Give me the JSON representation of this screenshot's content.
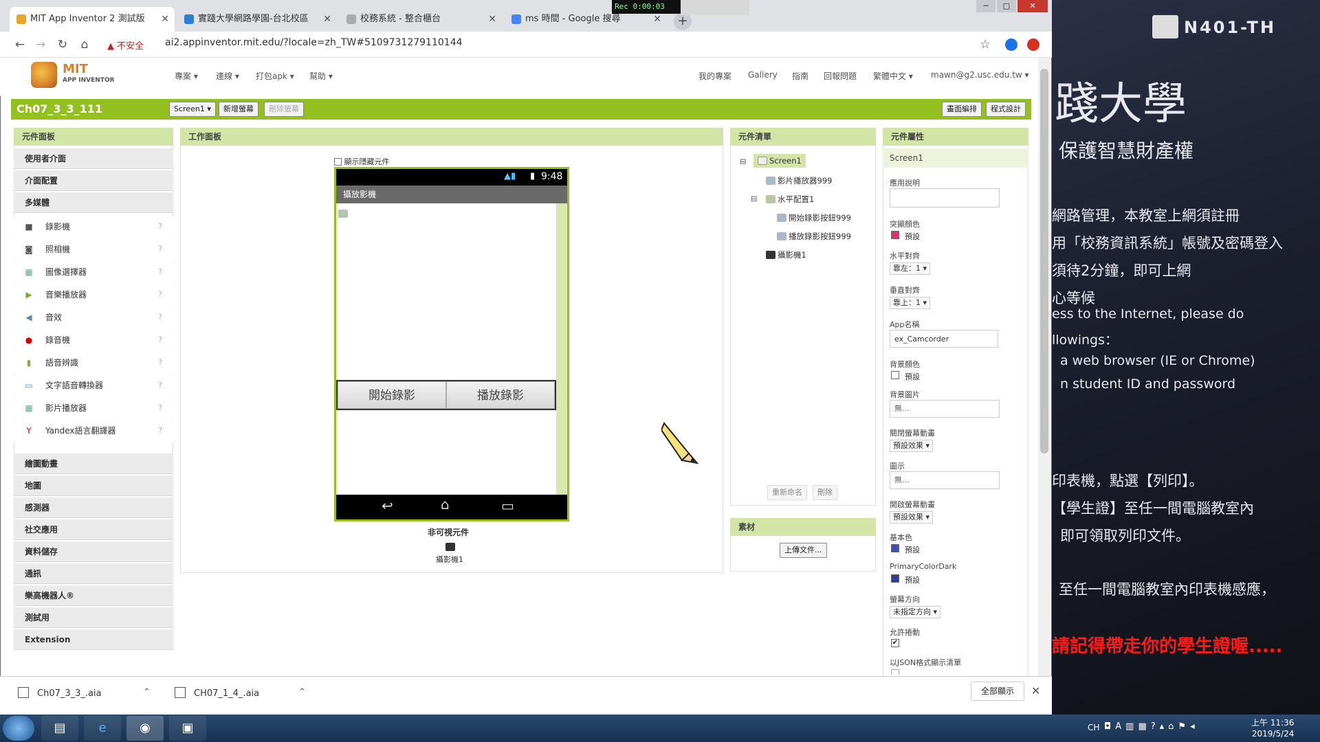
{
  "recorder": {
    "time": "Rec 0:00:03"
  },
  "tabs": [
    {
      "label": "MIT App Inventor 2 測試版",
      "color": "#e3a72f"
    },
    {
      "label": "實踐大學網路學園-台北校區",
      "color": "#2c7dd3"
    },
    {
      "label": "校務系統 - 整合櫃台",
      "color": "#777777"
    },
    {
      "label": "ms 時間 - Google 搜尋",
      "color": "#4285f4"
    }
  ],
  "address": {
    "warn": "不安全",
    "url": "ai2.appinventor.mit.edu/?locale=zh_TW#5109731279110144"
  },
  "header": {
    "logo_title": "MIT",
    "logo_sub": "APP INVENTOR",
    "menus": [
      "專案 ▾",
      "連線 ▾",
      "打包apk ▾",
      "幫助 ▾"
    ],
    "right_menus": [
      "我的專案",
      "Gallery",
      "指南",
      "回報問題",
      "繁體中文 ▾",
      "mawn@g2.usc.edu.tw ▾"
    ]
  },
  "toolbar": {
    "project": "Ch07_3_3_111",
    "screen": "Screen1 ▾",
    "add_screen": "新增螢幕",
    "remove_screen": "刪除螢幕",
    "designer": "畫面編排",
    "blocks": "程式設計"
  },
  "palette": {
    "title": "元件面板",
    "categories_top": [
      "使用者介面",
      "介面配置",
      "多媒體"
    ],
    "items": [
      {
        "label": "錄影機",
        "icon": "video-camera-icon",
        "glyph": "■",
        "color": "#555"
      },
      {
        "label": "照相機",
        "icon": "camera-icon",
        "glyph": "◙",
        "color": "#555"
      },
      {
        "label": "圖像選擇器",
        "icon": "image-picker-icon",
        "glyph": "▦",
        "color": "#6a8"
      },
      {
        "label": "音樂播放器",
        "icon": "player-icon",
        "glyph": "▶",
        "color": "#7a3"
      },
      {
        "label": "音效",
        "icon": "sound-icon",
        "glyph": "◀",
        "color": "#58a"
      },
      {
        "label": "錄音機",
        "icon": "recorder-icon",
        "glyph": "●",
        "color": "#d00"
      },
      {
        "label": "語音辨識",
        "icon": "speech-recognizer-icon",
        "glyph": "▮",
        "color": "#8a4"
      },
      {
        "label": "文字語音轉換器",
        "icon": "text-to-speech-icon",
        "glyph": "▭",
        "color": "#58a"
      },
      {
        "label": "影片播放器",
        "icon": "video-player-icon",
        "glyph": "▦",
        "color": "#6a8"
      },
      {
        "label": "Yandex語言翻譯器",
        "icon": "yandex-icon",
        "glyph": "Y",
        "color": "#d00"
      }
    ],
    "categories_bottom": [
      "繪圖動畫",
      "地圖",
      "感測器",
      "社交應用",
      "資料儲存",
      "通訊",
      "樂高機器人®",
      "測試用",
      "Extension"
    ]
  },
  "viewer": {
    "title": "工作面板",
    "show_hidden": "顯示隱藏元件",
    "status_time": "9:48",
    "screen_title": "攝放影機",
    "buttons": [
      "開始錄影",
      "播放錄影"
    ],
    "nonvisible_label": "非可視元件",
    "nonvisible_item": "攝影機1"
  },
  "tree": {
    "title": "元件清單",
    "items": [
      "Screen1",
      "影片播放器999",
      "水平配置1",
      "開始錄影按鈕999",
      "播放錄影按鈕999",
      "攝影機1"
    ],
    "rename": "重新命名",
    "delete": "刪除"
  },
  "media": {
    "title": "素材",
    "upload": "上傳文件..."
  },
  "props": {
    "title": "元件屬性",
    "component": "Screen1",
    "about_label": "應用說明",
    "accent_label": "突顯顏色",
    "accent_value": "預設",
    "accent_color": "#e0326a",
    "halign_label": "水平對齊",
    "halign_value": "靠左：1 ▾",
    "valign_label": "垂直對齊",
    "valign_value": "靠上：1 ▾",
    "appname_label": "App名稱",
    "appname_value": "ex_Camcorder",
    "bgcolor_label": "背景顏色",
    "bgcolor_value": "預設",
    "bgcolor_color": "#ffffff",
    "bgimage_label": "背景圖片",
    "bgimage_value": "無...",
    "close_anim_label": "關閉螢幕動畫",
    "close_anim_value": "預設效果 ▾",
    "icon_label": "圖示",
    "icon_value": "無...",
    "open_anim_label": "開啟螢幕動畫",
    "open_anim_value": "預設效果 ▾",
    "primary_label": "基本色",
    "primary_value": "預設",
    "primary_color": "#3f51b5",
    "primary_dark_label": "PrimaryColorDark",
    "primary_dark_value": "預設",
    "primary_dark_color": "#303f9f",
    "orient_label": "螢幕方向",
    "orient_value": "未指定方向 ▾",
    "scroll_label": "允許捲動",
    "json_label": "以JSON格式顯示清單"
  },
  "downloads": {
    "files": [
      "Ch07_3_3_.aia",
      "CH07_1_4_.aia"
    ],
    "show_all": "全部顯示"
  },
  "background": {
    "room": "N401-TH",
    "school": "踐大學",
    "lines": [
      "保護智慧財產權",
      "網路管理，本教室上網須註冊",
      "用「校務資訊系統」帳號及密碼登入",
      "須待2分鐘，即可上網",
      "心等候",
      "ess to the Internet, please do",
      "llowings：",
      "a web browser (IE or Chrome)",
      "n student ID and password",
      "印表機，點選【列印】。",
      "【學生證】至任一間電腦教室內",
      "即可領取列印文件。",
      "至任一間電腦教室內印表機感應，",
      "請記得帶走你的學生證喔....."
    ]
  },
  "taskbar": {
    "lang": "CH",
    "time": "上午 11:36",
    "date": "2019/5/24"
  }
}
